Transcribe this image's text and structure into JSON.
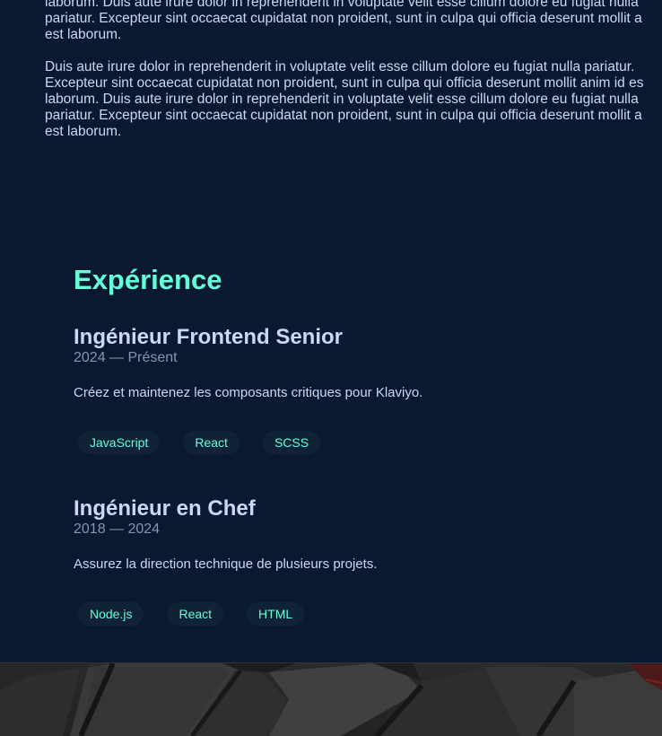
{
  "about": {
    "paragraph_1": "laborum. Duis aute irure dolor in reprehenderit in voluptate velit esse cillum dolore eu fugiat nulla\npariatur. Excepteur sint occaecat cupidatat non proident, sunt in culpa qui officia deserunt mollit a\nest laborum.",
    "paragraph_2": "Duis aute irure dolor in reprehenderit in voluptate velit esse cillum dolore eu fugiat nulla pariatur.\nExcepteur sint occaecat cupidatat non proident, sunt in culpa qui officia deserunt mollit anim id es\nlaborum. Duis aute irure dolor in reprehenderit in voluptate velit esse cillum dolore eu fugiat nulla\npariatur. Excepteur sint occaecat cupidatat non proident, sunt in culpa qui officia deserunt mollit a\nest laborum."
  },
  "experience": {
    "title": "Expérience",
    "jobs": [
      {
        "title": "Ingénieur Frontend Senior",
        "dates": "2024 — Présent",
        "description": "Créez et maintenez les composants critiques pour Klaviyo.",
        "tags": [
          "JavaScript",
          "React",
          "SCSS"
        ]
      },
      {
        "title": "Ingénieur en Chef",
        "dates": "2018 — 2024",
        "description": "Assurez la direction technique de plusieurs projets.",
        "tags": [
          "Node.js",
          "React",
          "HTML"
        ]
      }
    ]
  },
  "colors": {
    "background": "#0b1930",
    "accent": "#64ffda",
    "text": "#ccd6f6",
    "muted": "#8892b0",
    "tag_background": "#0f2236"
  }
}
